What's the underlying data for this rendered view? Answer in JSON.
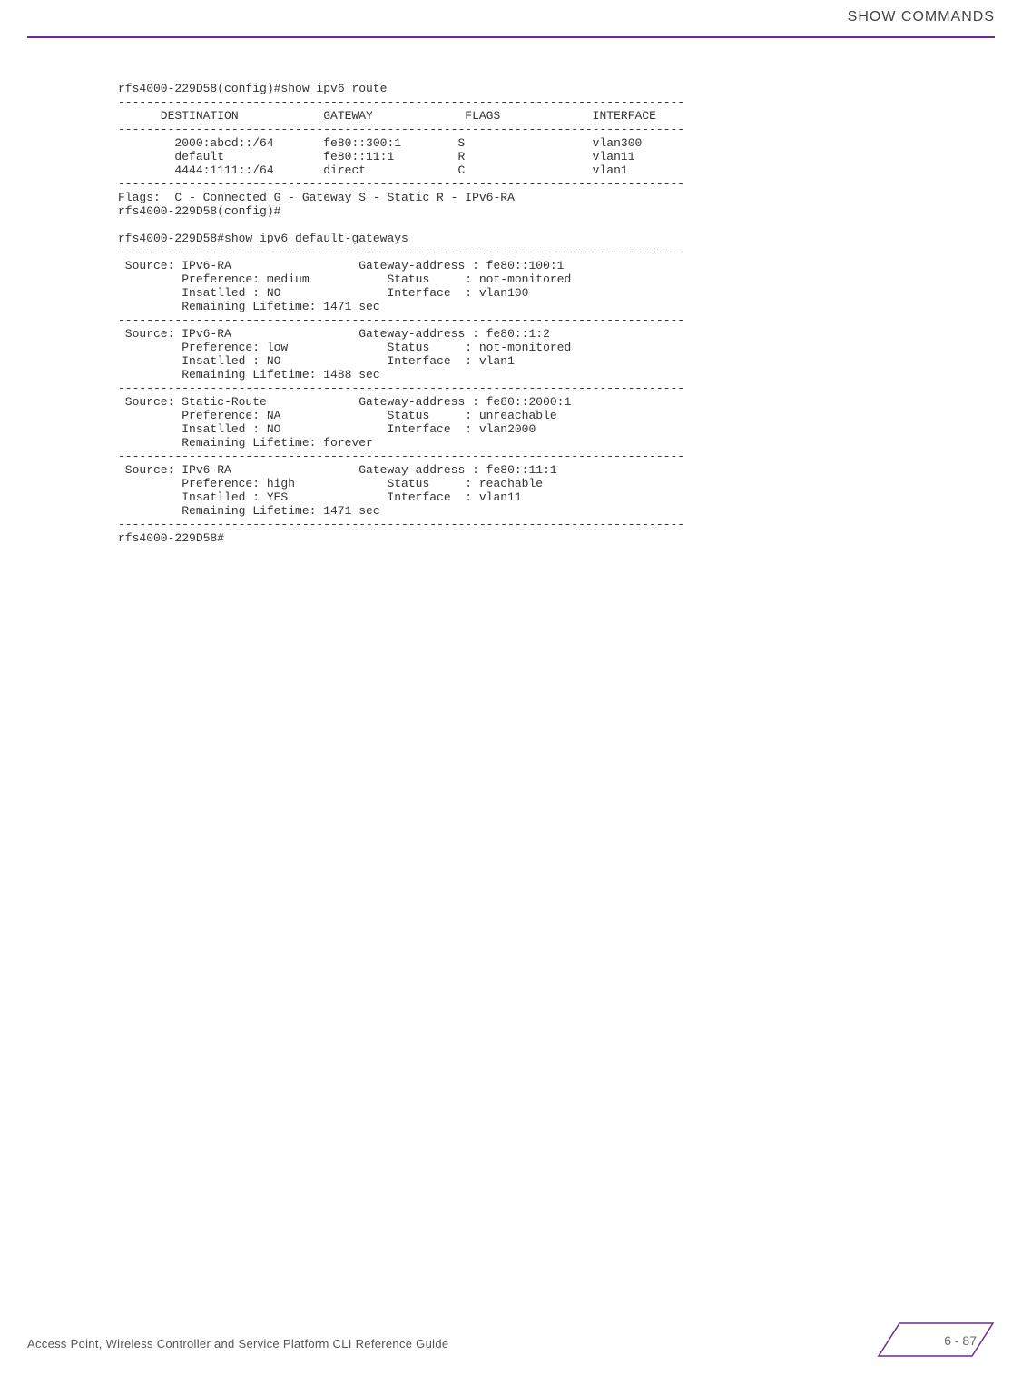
{
  "header": {
    "title": "SHOW COMMANDS"
  },
  "terminal_text": "rfs4000-229D58(config)#show ipv6 route\n--------------------------------------------------------------------------------\n      DESTINATION            GATEWAY             FLAGS             INTERFACE\n--------------------------------------------------------------------------------\n        2000:abcd::/64       fe80::300:1        S                  vlan300\n        default              fe80::11:1         R                  vlan11\n        4444:1111::/64       direct             C                  vlan1\n--------------------------------------------------------------------------------\nFlags:  C - Connected G - Gateway S - Static R - IPv6-RA\nrfs4000-229D58(config)#\n\nrfs4000-229D58#show ipv6 default-gateways\n--------------------------------------------------------------------------------\n Source: IPv6-RA                  Gateway-address : fe80::100:1\n         Preference: medium           Status     : not-monitored\n         Insatlled : NO               Interface  : vlan100\n         Remaining Lifetime: 1471 sec\n--------------------------------------------------------------------------------\n Source: IPv6-RA                  Gateway-address : fe80::1:2\n         Preference: low              Status     : not-monitored\n         Insatlled : NO               Interface  : vlan1\n         Remaining Lifetime: 1488 sec\n--------------------------------------------------------------------------------\n Source: Static-Route             Gateway-address : fe80::2000:1\n         Preference: NA               Status     : unreachable\n         Insatlled : NO               Interface  : vlan2000\n         Remaining Lifetime: forever\n--------------------------------------------------------------------------------\n Source: IPv6-RA                  Gateway-address : fe80::11:1\n         Preference: high             Status     : reachable\n         Insatlled : YES              Interface  : vlan11\n         Remaining Lifetime: 1471 sec\n--------------------------------------------------------------------------------\nrfs4000-229D58#",
  "footer": {
    "text": "Access Point, Wireless Controller and Service Platform CLI Reference Guide",
    "page": "6 - 87"
  }
}
